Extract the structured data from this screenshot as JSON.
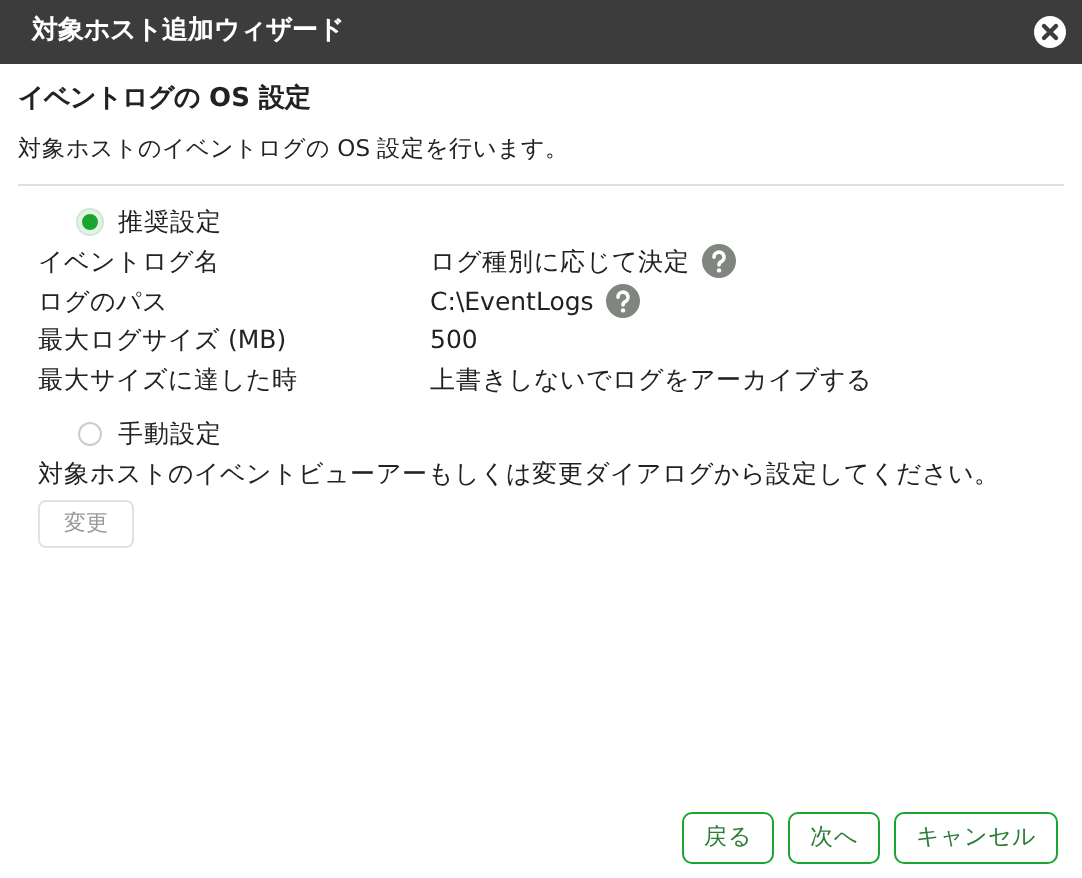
{
  "window": {
    "title": "対象ホスト追加ウィザード"
  },
  "heading": "イベントログの OS 設定",
  "description": "対象ホストのイベントログの OS 設定を行います。",
  "options": [
    {
      "label": "推奨設定",
      "selected": true,
      "settings": [
        {
          "name": "イベントログ名",
          "value": "ログ種別に応じて決定",
          "help": true
        },
        {
          "name": "ログのパス",
          "value": "C:\\EventLogs",
          "help": true
        },
        {
          "name": "最大ログサイズ (MB)",
          "value": "500",
          "help": false
        },
        {
          "name": "最大サイズに達した時",
          "value": "上書きしないでログをアーカイブする",
          "help": false
        }
      ]
    },
    {
      "label": "手動設定",
      "selected": false,
      "note": "対象ホストのイベントビューアーもしくは変更ダイアログから設定してください。",
      "button": {
        "label": "変更",
        "disabled": true
      }
    }
  ],
  "footer_buttons": [
    "戻る",
    "次へ",
    "キャンセル"
  ]
}
